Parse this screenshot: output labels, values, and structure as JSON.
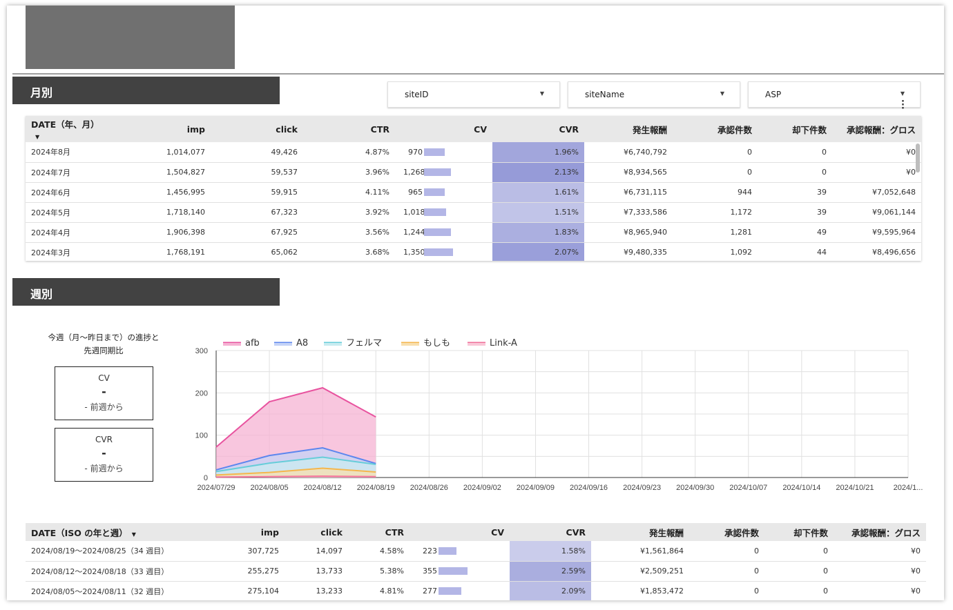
{
  "section_monthly": "月別",
  "section_weekly": "週別",
  "filters": [
    {
      "label": "siteID"
    },
    {
      "label": "siteName"
    },
    {
      "label": "ASP"
    }
  ],
  "monthly_table": {
    "headers": [
      "DATE（年、月）",
      "imp",
      "click",
      "CTR",
      "CV",
      "CVR",
      "発生報酬",
      "承認件数",
      "却下件数",
      "承認報酬：グロス"
    ],
    "rows": [
      {
        "date": "2024年8月",
        "imp": "1,014,077",
        "click": "49,426",
        "ctr": "4.87%",
        "cv": "970",
        "cv_value": 970,
        "cvr": "1.96%",
        "cvr_value": 1.96,
        "reward": "¥6,740,792",
        "approved": "0",
        "rejected": "0",
        "gross": "¥0"
      },
      {
        "date": "2024年7月",
        "imp": "1,504,827",
        "click": "59,537",
        "ctr": "3.96%",
        "cv": "1,268",
        "cv_value": 1268,
        "cvr": "2.13%",
        "cvr_value": 2.13,
        "reward": "¥8,934,565",
        "approved": "0",
        "rejected": "0",
        "gross": "¥0"
      },
      {
        "date": "2024年6月",
        "imp": "1,456,995",
        "click": "59,915",
        "ctr": "4.11%",
        "cv": "965",
        "cv_value": 965,
        "cvr": "1.61%",
        "cvr_value": 1.61,
        "reward": "¥6,731,115",
        "approved": "944",
        "rejected": "39",
        "gross": "¥7,052,648"
      },
      {
        "date": "2024年5月",
        "imp": "1,718,140",
        "click": "67,323",
        "ctr": "3.92%",
        "cv": "1,018",
        "cv_value": 1018,
        "cvr": "1.51%",
        "cvr_value": 1.51,
        "reward": "¥7,333,586",
        "approved": "1,172",
        "rejected": "39",
        "gross": "¥9,061,144"
      },
      {
        "date": "2024年4月",
        "imp": "1,906,398",
        "click": "67,925",
        "ctr": "3.56%",
        "cv": "1,244",
        "cv_value": 1244,
        "cvr": "1.83%",
        "cvr_value": 1.83,
        "reward": "¥8,965,940",
        "approved": "1,281",
        "rejected": "49",
        "gross": "¥9,595,964"
      },
      {
        "date": "2024年3月",
        "imp": "1,768,191",
        "click": "65,062",
        "ctr": "3.68%",
        "cv": "1,350",
        "cv_value": 1350,
        "cvr": "2.07%",
        "cvr_value": 2.07,
        "reward": "¥9,480,335",
        "approved": "1,092",
        "rejected": "44",
        "gross": "¥8,496,656"
      }
    ]
  },
  "kpi": {
    "caption_line1": "今週（月〜昨日まで）の進捗と",
    "caption_line2": "先週同期比",
    "cards": [
      {
        "label": "CV",
        "value": "-",
        "sub": "- 前週から"
      },
      {
        "label": "CVR",
        "value": "-",
        "sub": "- 前週から"
      }
    ]
  },
  "chart_data": {
    "type": "area",
    "x": [
      "2024/07/29",
      "2024/08/05",
      "2024/08/12",
      "2024/08/19",
      "2024/08/26",
      "2024/09/02",
      "2024/09/09",
      "2024/09/16",
      "2024/09/23",
      "2024/09/30",
      "2024/10/07",
      "2024/10/14",
      "2024/10/21",
      "2024/1..."
    ],
    "ylim": [
      0,
      300
    ],
    "yticks": [
      0,
      100,
      200,
      300
    ],
    "legend_position": "top-left",
    "grid": true,
    "series": [
      {
        "name": "afb",
        "color": "#e8539f",
        "fill": "#f5b3d3",
        "values": [
          72,
          179,
          212,
          143
        ]
      },
      {
        "name": "A8",
        "color": "#5c86ee",
        "fill": "#c5d3f7",
        "values": [
          18,
          52,
          70,
          33
        ]
      },
      {
        "name": "フェルマ",
        "color": "#66cdd9",
        "fill": "#c9ecf0",
        "values": [
          14,
          34,
          48,
          31
        ]
      },
      {
        "name": "もしも",
        "color": "#f5b64c",
        "fill": "#f8dfae",
        "values": [
          6,
          12,
          22,
          13
        ]
      },
      {
        "name": "Link-A",
        "color": "#f06f98",
        "fill": "#f9c8d8",
        "values": [
          1,
          2,
          3,
          2
        ]
      }
    ]
  },
  "weekly_table": {
    "headers": [
      "DATE（ISO の年と週）",
      "imp",
      "click",
      "CTR",
      "CV",
      "CVR",
      "発生報酬",
      "承認件数",
      "却下件数",
      "承認報酬：グロス"
    ],
    "rows": [
      {
        "date": "2024/08/19〜2024/08/25（34 週目）",
        "imp": "307,725",
        "click": "14,097",
        "ctr": "4.58%",
        "cv": "223",
        "cv_value": 223,
        "cvr": "1.58%",
        "cvr_value": 1.58,
        "reward": "¥1,561,864",
        "approved": "0",
        "rejected": "0",
        "gross": "¥0"
      },
      {
        "date": "2024/08/12〜2024/08/18（33 週目）",
        "imp": "255,275",
        "click": "13,733",
        "ctr": "5.38%",
        "cv": "355",
        "cv_value": 355,
        "cvr": "2.59%",
        "cvr_value": 2.59,
        "reward": "¥2,509,251",
        "approved": "0",
        "rejected": "0",
        "gross": "¥0"
      },
      {
        "date": "2024/08/05〜2024/08/11（32 週目）",
        "imp": "275,104",
        "click": "13,233",
        "ctr": "4.81%",
        "cv": "277",
        "cv_value": 277,
        "cvr": "2.09%",
        "cvr_value": 2.09,
        "reward": "¥1,853,472",
        "approved": "0",
        "rejected": "0",
        "gross": "¥0"
      }
    ]
  }
}
